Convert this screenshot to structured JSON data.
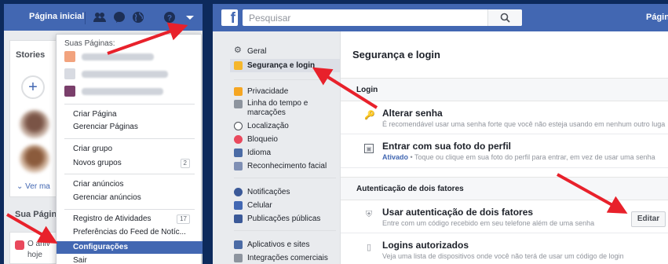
{
  "left_panel": {
    "topbar": {
      "home_label": "Página inicial"
    },
    "stories": {
      "title": "Stories",
      "add_symbol": "+",
      "see_more": "Ver ma"
    },
    "your_pages": {
      "title": "Sua Págin",
      "card_text": "O aniv hoje"
    },
    "dropdown": {
      "your_pages_label": "Suas Páginas:",
      "items": [
        {
          "label": "Criar Página"
        },
        {
          "label": "Gerenciar Páginas"
        },
        {
          "label": "Criar grupo"
        },
        {
          "label": "Novos grupos",
          "count": "2"
        },
        {
          "label": "Criar anúncios"
        },
        {
          "label": "Gerenciar anúncios"
        },
        {
          "label": "Registro de Atividades",
          "count": "17"
        },
        {
          "label": "Preferências do Feed de Notíc..."
        },
        {
          "label": "Configurações"
        },
        {
          "label": "Sair"
        }
      ]
    }
  },
  "right_panel": {
    "topbar": {
      "logo": "f",
      "search_placeholder": "Pesquisar",
      "home_label": "Págin"
    },
    "nav": {
      "items": [
        {
          "label": "Geral",
          "icon": "gear-icon"
        },
        {
          "label": "Segurança e login",
          "icon": "shield-icon"
        },
        {
          "label": "Privacidade",
          "icon": "lock-icon"
        },
        {
          "label": "Linha do tempo e marcações",
          "icon": "timeline-icon"
        },
        {
          "label": "Localização",
          "icon": "location-icon"
        },
        {
          "label": "Bloqueio",
          "icon": "block-icon"
        },
        {
          "label": "Idioma",
          "icon": "language-icon"
        },
        {
          "label": "Reconhecimento facial",
          "icon": "face-icon"
        },
        {
          "label": "Notificações",
          "icon": "globe-icon"
        },
        {
          "label": "Celular",
          "icon": "mobile-icon"
        },
        {
          "label": "Publicações públicas",
          "icon": "rss-icon"
        },
        {
          "label": "Aplicativos e sites",
          "icon": "apps-icon"
        },
        {
          "label": "Integrações comerciais",
          "icon": "business-icon"
        }
      ]
    },
    "content": {
      "title": "Segurança e login",
      "section_login": "Login",
      "change_password": {
        "title": "Alterar senha",
        "desc": "É recomendável usar uma senha forte que você não esteja usando em nenhum outro luga"
      },
      "profile_photo_login": {
        "title": "Entrar com sua foto do perfil",
        "status": "Ativado",
        "desc": " • Toque ou clique em sua foto do perfil para entrar, em vez de usar uma senha"
      },
      "section_2fa": "Autenticação de dois fatores",
      "two_factor": {
        "title": "Usar autenticação de dois fatores",
        "desc": "Entre com um código recebido em seu telefone além de uma senha",
        "button": "Editar"
      },
      "authorized_logins": {
        "title": "Logins autorizados",
        "desc": "Veja uma lista de dispositivos onde você não terá de usar um código de login"
      }
    }
  },
  "colors": {
    "facebook_blue": "#4267b2",
    "arrow_red": "#e8212b",
    "background_navy": "#0d2a5c"
  }
}
